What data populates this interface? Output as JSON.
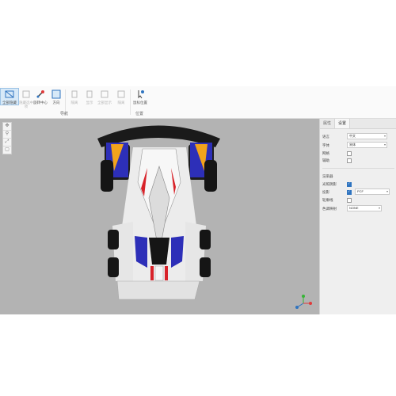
{
  "toolbar": {
    "tools": [
      {
        "label": "全部隐藏"
      },
      {
        "label": "隐藏选中项"
      },
      {
        "label": "旋转中心"
      },
      {
        "label": "方向"
      },
      {
        "label": "隔离"
      },
      {
        "label": "显示"
      },
      {
        "label": "全部显示"
      },
      {
        "label": "隔离"
      },
      {
        "label": "鼠标位置"
      }
    ],
    "groups": {
      "nav": "导航",
      "position": "位置"
    }
  },
  "panel": {
    "tabs": [
      "属性",
      "设置"
    ],
    "settings": {
      "language_label": "语言",
      "language_value": "中文",
      "font_label": "字体",
      "font_value": "宋体",
      "grid_label": "网格",
      "aux_label": "辅助",
      "render_label": "渲染器",
      "shadow_label": "光照阴影",
      "shadow_value": "PCF",
      "projection_label": "投影",
      "edge_label": "轮廓线",
      "tonemap_label": "色调映射",
      "tonemap_value": "NONE"
    }
  },
  "colors": {
    "accent": "#2f74c0",
    "viewport": "#b3b3b3"
  }
}
